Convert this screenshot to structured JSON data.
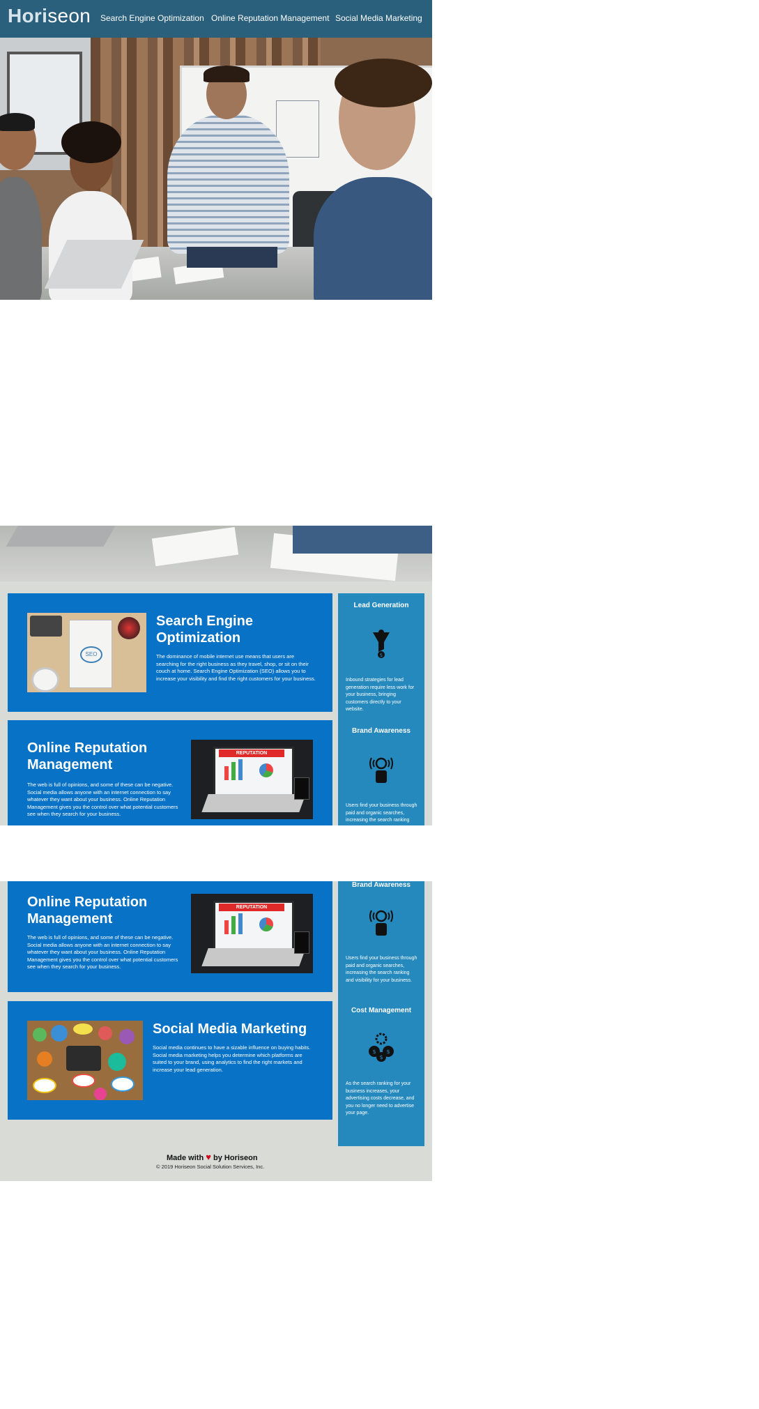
{
  "header": {
    "logo_primary": "Hori",
    "logo_secondary": "seon",
    "nav": [
      "Search Engine Optimization",
      "Online Reputation Management",
      "Social Media Marketing"
    ]
  },
  "cards": {
    "seo": {
      "title": "Search Engine Optimization",
      "body": "The dominance of mobile internet use means that users are searching for the right business as they travel, shop, or sit on their couch at home. Search Engine Optimization (SEO) allows you to increase your visibility and find the right customers for your business."
    },
    "orm": {
      "title": "Online Reputation Management",
      "body": "The web is full of opinions, and some of these can be negative. Social media allows anyone with an internet connection to say whatever they want about your business. Online Reputation Management gives you the control over what potential customers see when they search for your business.",
      "thumb_text": "REPUTATION"
    },
    "smm": {
      "title": "Social Media Marketing",
      "body": "Social media continues to have a sizable influence on buying habits. Social media marketing helps you determine which platforms are suited to your brand, using analytics to find the right markets and increase your lead generation."
    }
  },
  "aside": {
    "lead": {
      "title": "Lead Generation",
      "body": "Inbound strategies for lead generation require less work for your business, bringing customers directly to your website."
    },
    "brand": {
      "title": "Brand Awareness",
      "body": "Users find your business through paid and organic searches, increasing the search ranking and visibility for your business."
    },
    "cost": {
      "title": "Cost Management",
      "body": "As the search ranking for your business increases, your advertising costs decrease, and you no longer need to advertise your page."
    }
  },
  "footer": {
    "made_prefix": "Made with",
    "heart": "♥",
    "made_suffix": "by Horiseon",
    "copyright": "© 2019 Horiseon Social Solution Services, Inc."
  },
  "colors": {
    "header": "#2a607c",
    "card": "#0872c6",
    "aside": "#2589be",
    "page_background": "#d9dbd7"
  },
  "icons": [
    "lead-generation-icon",
    "brand-awareness-icon",
    "cost-management-icon",
    "heart-icon"
  ]
}
